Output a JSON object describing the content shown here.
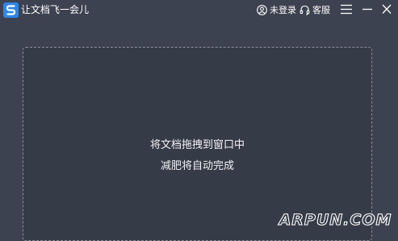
{
  "window": {
    "title": "让文档飞一会儿",
    "logo_icon": "app-logo-s-icon"
  },
  "header": {
    "login_label": "未登录",
    "login_icon": "user-icon",
    "service_label": "客服",
    "service_icon": "headset-icon",
    "menu_icon": "hamburger-menu-icon",
    "minimize_icon": "minimize-icon",
    "close_icon": "close-icon"
  },
  "dropzone": {
    "line1": "将文档拖拽到窗口中",
    "line2": "减肥将自动完成"
  },
  "watermark": {
    "text": "ARPUN.COM"
  },
  "colors": {
    "background": "#3d4250",
    "dropzone_background": "#363b48",
    "dashed_border": "#8a8f99",
    "logo_blue": "#2f86e6",
    "text": "#ffffff"
  }
}
